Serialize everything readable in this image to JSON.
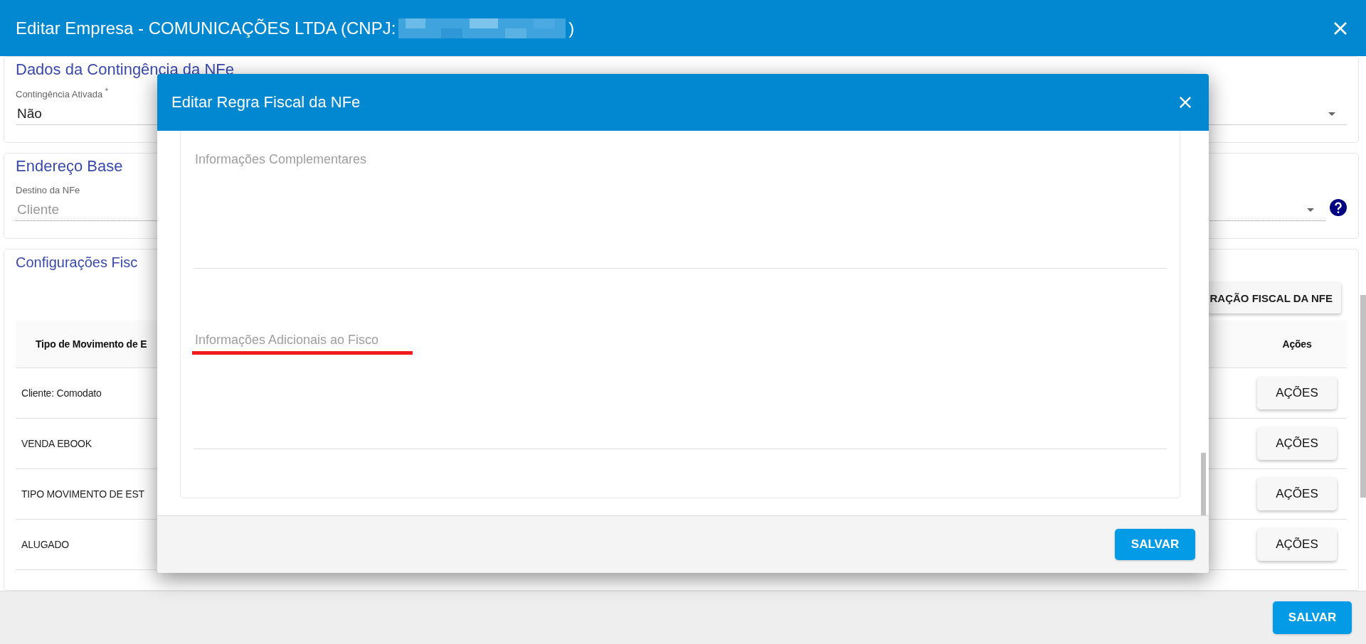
{
  "window": {
    "title": "Editar Empresa - COMUNICAÇÕES LTDA (CNPJ:",
    "title_end": ")"
  },
  "sections": [
    {
      "title": "Dados da Contingência da NFe",
      "field": {
        "label": "Contingência Ativada $^{*}$",
        "value": "Não",
        "disabled": false,
        "help": false
      }
    },
    {
      "title": "Endereço Base",
      "field": {
        "label": "Destino da NFe",
        "value": "Cliente",
        "disabled": true,
        "help": true
      }
    }
  ],
  "fiscal": {
    "title": "Configurações Fisc",
    "button": "RAÇÃO FISCAL DA NFE",
    "columns": [
      "Tipo de Movimento de E",
      "Ações"
    ],
    "rows": [
      {
        "type": "Cliente: Comodato",
        "action": "AÇÕES"
      },
      {
        "type": "VENDA EBOOK",
        "action": "AÇÕES"
      },
      {
        "type": "TIPO MOVIMENTO DE EST",
        "action": "AÇÕES"
      },
      {
        "type": "ALUGADO",
        "action": "AÇÕES"
      }
    ]
  },
  "footer": {
    "button": "SALVAR"
  },
  "modal": {
    "title": "Editar Regra Fiscal da NFe",
    "fields": [
      {
        "placeholder": "Informações Complementares",
        "highlighted": false
      },
      {
        "placeholder": "Informações Adicionais ao Fisco",
        "highlighted": true
      }
    ],
    "button": "SALVAR"
  }
}
